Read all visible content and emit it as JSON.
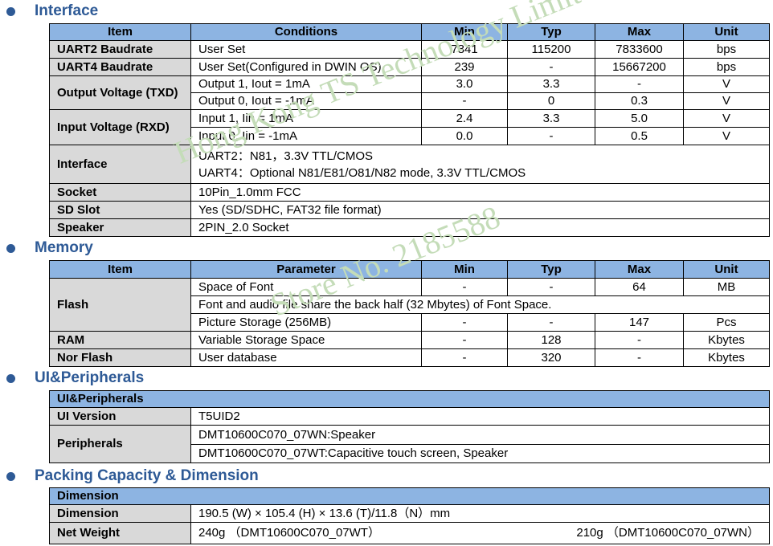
{
  "sections": {
    "interface": "Interface",
    "memory": "Memory",
    "ui_peripherals": "UI&Peripherals",
    "packing": "Packing Capacity & Dimension"
  },
  "interface_table": {
    "headers": [
      "Item",
      "Conditions",
      "Min",
      "Typ",
      "Max",
      "Unit"
    ],
    "uart2": {
      "item": "UART2 Baudrate",
      "cond": "User Set",
      "min": "7841",
      "typ": "115200",
      "max": "7833600",
      "unit": "bps"
    },
    "uart4": {
      "item": "UART4 Baudrate",
      "cond": "User Set(Configured in DWIN OS)",
      "min": "239",
      "typ": "-",
      "max": "15667200",
      "unit": "bps"
    },
    "output_voltage": {
      "item": "Output Voltage (TXD)",
      "row1": {
        "cond": "Output 1, Iout = 1mA",
        "min": "3.0",
        "typ": "3.3",
        "max": "-",
        "unit": "V"
      },
      "row2": {
        "cond": "Output 0, Iout = -1mA",
        "min": "-",
        "typ": "0",
        "max": "0.3",
        "unit": "V"
      }
    },
    "input_voltage": {
      "item": "Input Voltage (RXD)",
      "row1": {
        "cond": "Input 1, Iin = 1mA",
        "min": "2.4",
        "typ": "3.3",
        "max": "5.0",
        "unit": "V"
      },
      "row2": {
        "cond": "Input 0, Iin = -1mA",
        "min": "0.0",
        "typ": "-",
        "max": "0.5",
        "unit": "V"
      }
    },
    "interface": {
      "item": "Interface",
      "line1": "UART2：N81，3.3V TTL/CMOS",
      "line2": "UART4：Optional N81/E81/O81/N82 mode, 3.3V TTL/CMOS"
    },
    "socket": {
      "item": "Socket",
      "value": "10Pin_1.0mm FCC"
    },
    "sd_slot": {
      "item": "SD Slot",
      "value": "Yes (SD/SDHC, FAT32 file format)"
    },
    "speaker": {
      "item": "Speaker",
      "value": "2PIN_2.0 Socket"
    }
  },
  "memory_table": {
    "headers": [
      "Item",
      "Parameter",
      "Min",
      "Typ",
      "Max",
      "Unit"
    ],
    "flash": {
      "item": "Flash",
      "row1": {
        "param": "Space of Font",
        "min": "-",
        "typ": "-",
        "max": "64",
        "unit": "MB"
      },
      "row2": {
        "param": "Font and audio file share the back half (32 Mbytes) of Font Space."
      },
      "row3": {
        "param": "Picture Storage (256MB)",
        "min": "-",
        "typ": "-",
        "max": "147",
        "unit": "Pcs"
      }
    },
    "ram": {
      "item": "RAM",
      "param": "Variable Storage Space",
      "min": "-",
      "typ": "128",
      "max": "-",
      "unit": "Kbytes"
    },
    "nor_flash": {
      "item": "Nor Flash",
      "param": "User database",
      "min": "-",
      "typ": "320",
      "max": "-",
      "unit": "Kbytes"
    }
  },
  "ui_table": {
    "header": "UI&Peripherals",
    "ui_version": {
      "item": "UI Version",
      "value": "T5UID2"
    },
    "peripherals": {
      "item": "Peripherals",
      "row1": "DMT10600C070_07WN:Speaker",
      "row2": "DMT10600C070_07WT:Capacitive touch screen, Speaker"
    }
  },
  "packing_table": {
    "header": "Dimension",
    "dimension": {
      "item": "Dimension",
      "value": "190.5 (W) × 105.4 (H) × 13.6 (T)/11.8（N）mm"
    },
    "net_weight": {
      "item": "Net Weight",
      "value1": "240g （DMT10600C070_07WT）",
      "value2": "210g （DMT10600C070_07WN）"
    }
  },
  "watermark": {
    "line1": "Hong Kong TS Technology Limited",
    "line2": "Store No. 2185588"
  },
  "colors": {
    "header_bg": "#8db4e2",
    "label_bg": "#d9d9d9",
    "section_title": "#2e5a96",
    "watermark": "#c4dcb8"
  }
}
